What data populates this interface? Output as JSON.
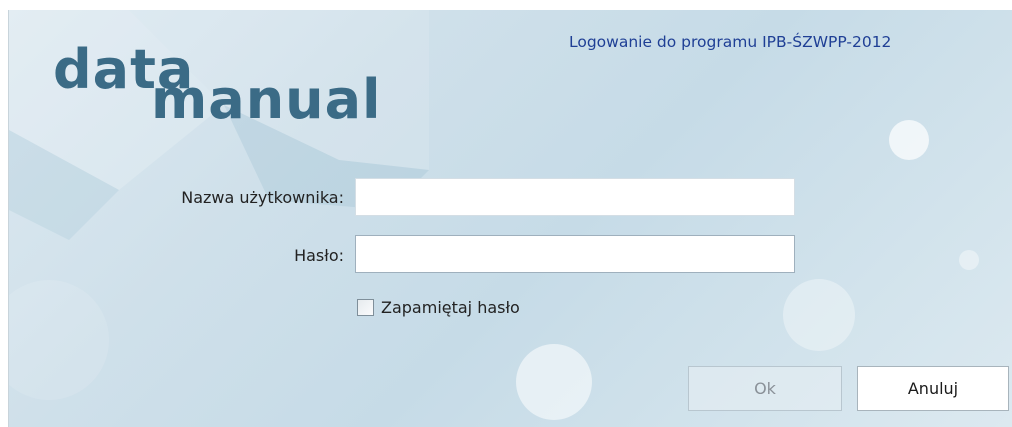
{
  "window": {
    "title": "Logowanie do programu IPB-ŚZWPP-2012"
  },
  "logo": {
    "part1": "data",
    "part2": "manual"
  },
  "form": {
    "username_label": "Nazwa użytkownika:",
    "username_value": "",
    "password_label": "Hasło:",
    "password_value": "",
    "remember_label": "Zapamiętaj hasło",
    "remember_checked": false
  },
  "buttons": {
    "ok_label": "Ok",
    "cancel_label": "Anuluj"
  },
  "colors": {
    "title_text": "#1f3f95",
    "logo_text": "#3b6b86",
    "background": "#cfe0ea"
  }
}
